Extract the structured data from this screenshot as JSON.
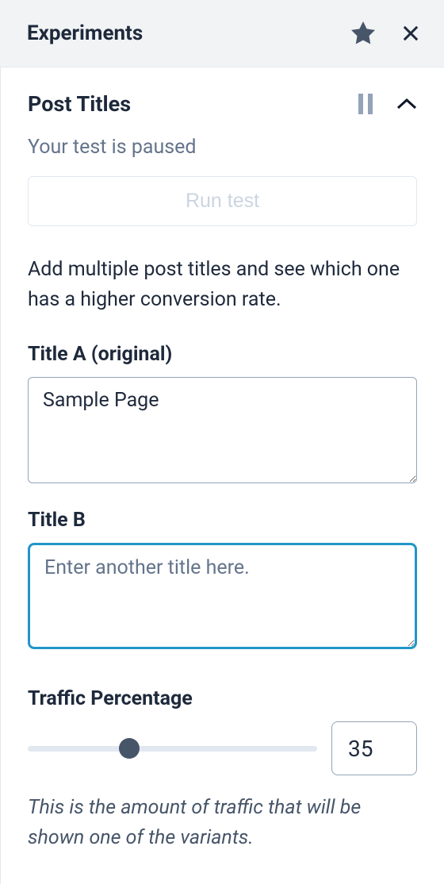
{
  "header": {
    "title": "Experiments"
  },
  "section": {
    "title": "Post Titles",
    "status": "Your test is paused",
    "run_button": "Run test",
    "description": "Add multiple post titles and see which one has a higher conversion rate."
  },
  "titleA": {
    "label": "Title A (original)",
    "value": "Sample Page"
  },
  "titleB": {
    "label": "Title B",
    "placeholder": "Enter another title here."
  },
  "traffic": {
    "label": "Traffic Percentage",
    "value": "35",
    "help": "This is the amount of traffic that will be shown one of the variants."
  }
}
